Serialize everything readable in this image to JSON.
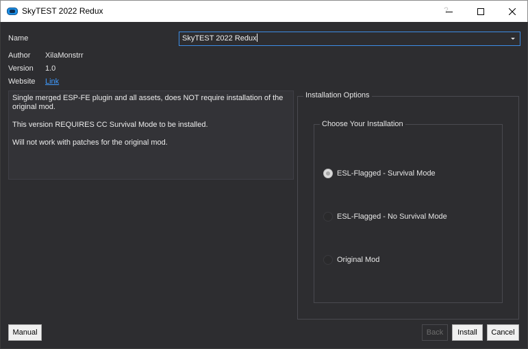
{
  "window": {
    "title": "SkyTEST 2022 Redux",
    "help_label": "?"
  },
  "fields": {
    "name_label": "Name",
    "name_value": "SkyTEST 2022 Redux",
    "author_label": "Author",
    "author_value": "XilaMonstrr",
    "version_label": "Version",
    "version_value": "1.0",
    "website_label": "Website",
    "website_value": "Link"
  },
  "description": {
    "paragraphs": [
      "Single merged ESP-FE plugin and all assets, does NOT require installation of the original mod.",
      "This version REQUIRES CC Survival Mode to be installed.",
      "Will not work with patches for the original mod."
    ]
  },
  "options": {
    "group_title": "Installation Options",
    "subgroup_title": "Choose Your Installation",
    "choices": [
      {
        "label": "ESL-Flagged - Survival Mode",
        "checked": true
      },
      {
        "label": "ESL-Flagged - No Survival Mode",
        "checked": false
      },
      {
        "label": "Original Mod",
        "checked": false
      }
    ]
  },
  "buttons": {
    "manual": "Manual",
    "back": "Back",
    "install": "Install",
    "cancel": "Cancel"
  },
  "colors": {
    "background": "#2d2d30",
    "accent": "#3d8ee8",
    "link": "#3f9bff"
  }
}
